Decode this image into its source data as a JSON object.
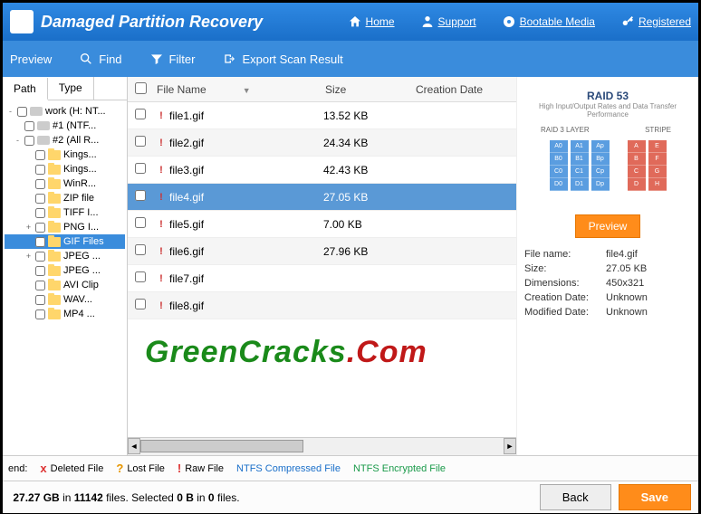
{
  "header": {
    "title": "Damaged Partition Recovery",
    "nav": {
      "home": "Home",
      "support": "Support",
      "bootable": "Bootable Media",
      "registered": "Registered"
    }
  },
  "toolbar": {
    "preview": "Preview",
    "find": "Find",
    "filter": "Filter",
    "export": "Export Scan Result"
  },
  "tabs": {
    "path": "Path",
    "type": "Type"
  },
  "tree": [
    {
      "label": "work (H: NT...",
      "kind": "drive",
      "indent": 0,
      "pm": "-",
      "sel": false
    },
    {
      "label": "#1 (NTF...",
      "kind": "drive",
      "indent": 1,
      "pm": "",
      "sel": false
    },
    {
      "label": "#2 (All R...",
      "kind": "drive",
      "indent": 1,
      "pm": "-",
      "sel": false
    },
    {
      "label": "Kings...",
      "kind": "folder",
      "indent": 2,
      "pm": "",
      "sel": false
    },
    {
      "label": "Kings...",
      "kind": "folder",
      "indent": 2,
      "pm": "",
      "sel": false
    },
    {
      "label": "WinR...",
      "kind": "folder",
      "indent": 2,
      "pm": "",
      "sel": false
    },
    {
      "label": "ZIP file",
      "kind": "folder",
      "indent": 2,
      "pm": "",
      "sel": false
    },
    {
      "label": "TIFF I...",
      "kind": "folder",
      "indent": 2,
      "pm": "",
      "sel": false
    },
    {
      "label": "PNG I...",
      "kind": "folder",
      "indent": 2,
      "pm": "+",
      "sel": false
    },
    {
      "label": "GIF Files",
      "kind": "folder",
      "indent": 2,
      "pm": "",
      "sel": true
    },
    {
      "label": "JPEG ...",
      "kind": "folder",
      "indent": 2,
      "pm": "+",
      "sel": false
    },
    {
      "label": "JPEG ...",
      "kind": "folder",
      "indent": 2,
      "pm": "",
      "sel": false
    },
    {
      "label": "AVI Clip",
      "kind": "folder",
      "indent": 2,
      "pm": "",
      "sel": false
    },
    {
      "label": "WAV...",
      "kind": "folder",
      "indent": 2,
      "pm": "",
      "sel": false
    },
    {
      "label": "MP4 ...",
      "kind": "folder",
      "indent": 2,
      "pm": "",
      "sel": false
    }
  ],
  "columns": {
    "name": "File Name",
    "size": "Size",
    "date": "Creation Date"
  },
  "files": [
    {
      "name": "file1.gif",
      "size": "13.52 KB",
      "sel": false
    },
    {
      "name": "file2.gif",
      "size": "24.34 KB",
      "sel": false
    },
    {
      "name": "file3.gif",
      "size": "42.43 KB",
      "sel": false
    },
    {
      "name": "file4.gif",
      "size": "27.05 KB",
      "sel": true
    },
    {
      "name": "file5.gif",
      "size": "7.00 KB",
      "sel": false
    },
    {
      "name": "file6.gif",
      "size": "27.96 KB",
      "sel": false
    },
    {
      "name": "file7.gif",
      "size": "",
      "sel": false
    },
    {
      "name": "file8.gif",
      "size": "",
      "sel": false
    }
  ],
  "preview": {
    "raid_title": "RAID 53",
    "raid_sub": "High Input/Output Rates and Data Transfer Performance",
    "layer1": "RAID 3 LAYER",
    "layer2": "STRIPE",
    "btn": "Preview",
    "meta": [
      {
        "k": "File name:",
        "v": "file4.gif"
      },
      {
        "k": "Size:",
        "v": "27.05 KB"
      },
      {
        "k": "Dimensions:",
        "v": "450x321"
      },
      {
        "k": "Creation Date:",
        "v": "Unknown"
      },
      {
        "k": "Modified Date:",
        "v": "Unknown"
      }
    ]
  },
  "legend": {
    "label": "end:",
    "deleted": "Deleted File",
    "lost": "Lost File",
    "raw": "Raw File",
    "compressed": "NTFS Compressed File",
    "encrypted": "NTFS Encrypted File"
  },
  "footer": {
    "status_gb": "27.27 GB",
    "status_in": "in",
    "status_files": "11142",
    "status_files_lbl": "files.  Selected",
    "status_b": "0 B",
    "status_in2": "in",
    "status_sel": "0",
    "status_sel_lbl": "files.",
    "back": "Back",
    "save": "Save"
  },
  "watermark": {
    "g1": "Green",
    "g2": "Cracks",
    "r": ".Com"
  }
}
